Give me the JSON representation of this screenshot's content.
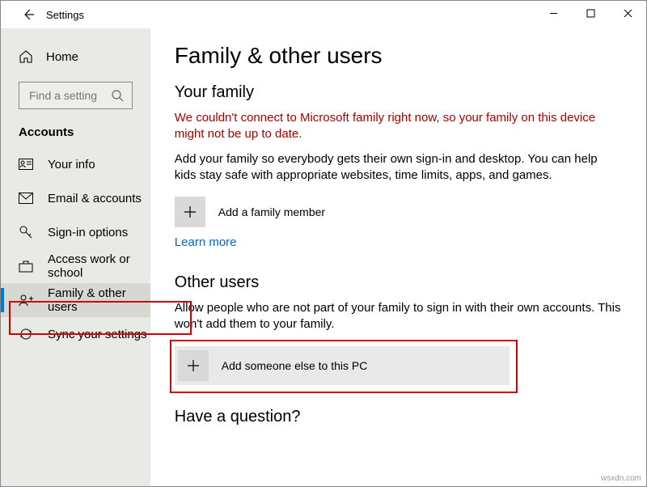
{
  "window": {
    "title": "Settings",
    "back_label": "Back"
  },
  "sidebar": {
    "home": "Home",
    "search_placeholder": "Find a setting",
    "section": "Accounts",
    "items": [
      {
        "label": "Your info"
      },
      {
        "label": "Email & accounts"
      },
      {
        "label": "Sign-in options"
      },
      {
        "label": "Access work or school"
      },
      {
        "label": "Family & other users"
      },
      {
        "label": "Sync your settings"
      }
    ]
  },
  "main": {
    "heading": "Family & other users",
    "family": {
      "heading": "Your family",
      "error": "We couldn't connect to Microsoft family right now, so your family on this device might not be up to date.",
      "desc": "Add your family so everybody gets their own sign-in and desktop. You can help kids stay safe with appropriate websites, time limits, apps, and games.",
      "add_label": "Add a family member",
      "learn_more": "Learn more"
    },
    "other": {
      "heading": "Other users",
      "desc": "Allow people who are not part of your family to sign in with their own accounts. This won't add them to your family.",
      "add_label": "Add someone else to this PC"
    },
    "question": "Have a question?"
  },
  "footer": {
    "watermark": "wsxdn.com"
  }
}
